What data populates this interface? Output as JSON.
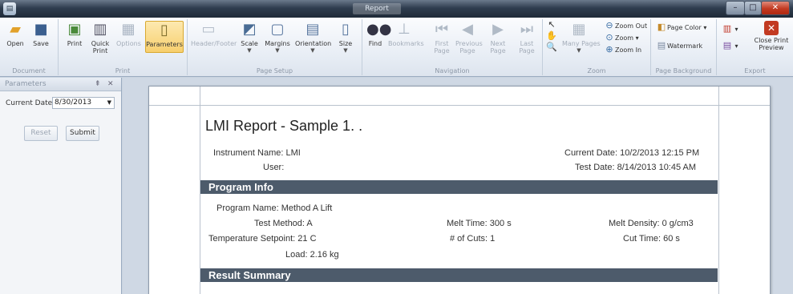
{
  "window": {
    "title": "Report"
  },
  "ribbon": {
    "groups": {
      "document": "Document",
      "print": "Print",
      "page_setup": "Page Setup",
      "navigation": "Navigation",
      "zoom": "Zoom",
      "page_background": "Page Background",
      "export": "Export"
    },
    "buttons": {
      "open": "Open",
      "save": "Save",
      "print": "Print",
      "quick_print": "Quick Print",
      "options": "Options",
      "parameters": "Parameters",
      "header_footer": "Header/Footer",
      "scale": "Scale",
      "margins": "Margins",
      "orientation": "Orientation",
      "size": "Size",
      "find": "Find",
      "bookmarks": "Bookmarks",
      "first_page": "First Page",
      "previous_page": "Previous Page",
      "next_page": "Next Page",
      "last_page": "Last Page",
      "many_pages": "Many Pages",
      "zoom_out": "Zoom Out",
      "zoom": "Zoom",
      "zoom_in": "Zoom In",
      "page_color": "Page Color",
      "watermark": "Watermark",
      "close_print_preview": "Close Print Preview"
    }
  },
  "parameters_pane": {
    "title": "Parameters",
    "current_date_label": "Current Date",
    "current_date_value": "8/30/2013",
    "reset_label": "Reset",
    "submit_label": "Submit"
  },
  "report": {
    "title": "LMI Report - Sample 1. .",
    "instrument_name": "Instrument Name: LMI",
    "user": "User:",
    "current_date": "Current Date: 10/2/2013 12:15 PM",
    "test_date": "Test Date: 8/14/2013 10:45 AM",
    "program_info_header": "Program Info",
    "program_name": "Program Name: Method A Lift",
    "test_method": "Test Method: A",
    "temperature_setpoint": "Temperature Setpoint: 21 C",
    "load": "Load: 2.16 kg",
    "melt_time": "Melt Time: 300 s",
    "num_cuts": "# of Cuts: 1",
    "melt_density": "Melt Density: 0 g/cm3",
    "cut_time": "Cut Time: 60 s",
    "result_summary_header": "Result Summary"
  },
  "colors": {
    "section_bar": "#4d5b6b",
    "close_button": "#c23a22",
    "selected_button": "#f7cf6e"
  },
  "icons": {
    "open": "folder-open-icon",
    "save": "floppy-disk-icon",
    "print": "printer-icon",
    "find": "binoculars-icon",
    "close": "close-icon"
  }
}
